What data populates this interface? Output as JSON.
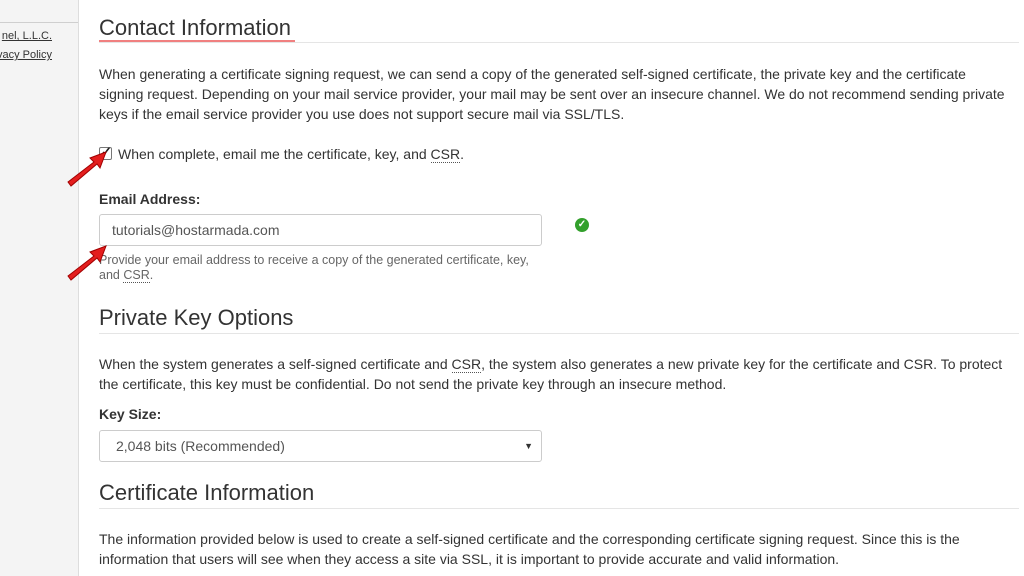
{
  "sidebar": {
    "link1": "nel, L.L.C.",
    "link2": "vacy Policy"
  },
  "contact": {
    "heading": "Contact Information",
    "description": "When generating a certificate signing request, we can send a copy of the generated self-signed certificate, the private key and the certificate signing request. Depending on your mail service provider, your mail may be sent over an insecure channel. We do not recommend sending private keys if the email service provider you use does not support secure mail via SSL/TLS.",
    "checkbox_label_prefix": "When complete, email me the certificate, key, and ",
    "checkbox_label_abbr": "CSR",
    "checkbox_label_suffix": ".",
    "checkbox_checked": true,
    "email_label": "Email Address:",
    "email_value": "tutorials@hostarmada.com",
    "email_help_prefix": "Provide your email address to receive a copy of the generated certificate, key, and ",
    "email_help_abbr": "CSR",
    "email_help_suffix": "."
  },
  "private_key": {
    "heading": "Private Key Options",
    "description_prefix": "When the system generates a self-signed certificate and ",
    "description_abbr": "CSR",
    "description_suffix": ", the system also generates a new private key for the certificate and CSR. To protect the certificate, this key must be confidential. Do not send the private key through an insecure method.",
    "key_size_label": "Key Size:",
    "key_size_value": "2,048 bits (Recommended)"
  },
  "certificate": {
    "heading": "Certificate Information",
    "description": "The information provided below is used to create a self-signed certificate and the corresponding certificate signing request. Since this is the information that users will see when they access a site via SSL, it is important to provide accurate and valid information."
  },
  "icons": {
    "valid": "check-circle-icon",
    "caret": "caret-down-icon",
    "annotation": "red-arrow-icon"
  },
  "colors": {
    "heading_underline": "#f08080",
    "valid_green": "#33a02c",
    "annotation_red": "#e41e1e"
  }
}
